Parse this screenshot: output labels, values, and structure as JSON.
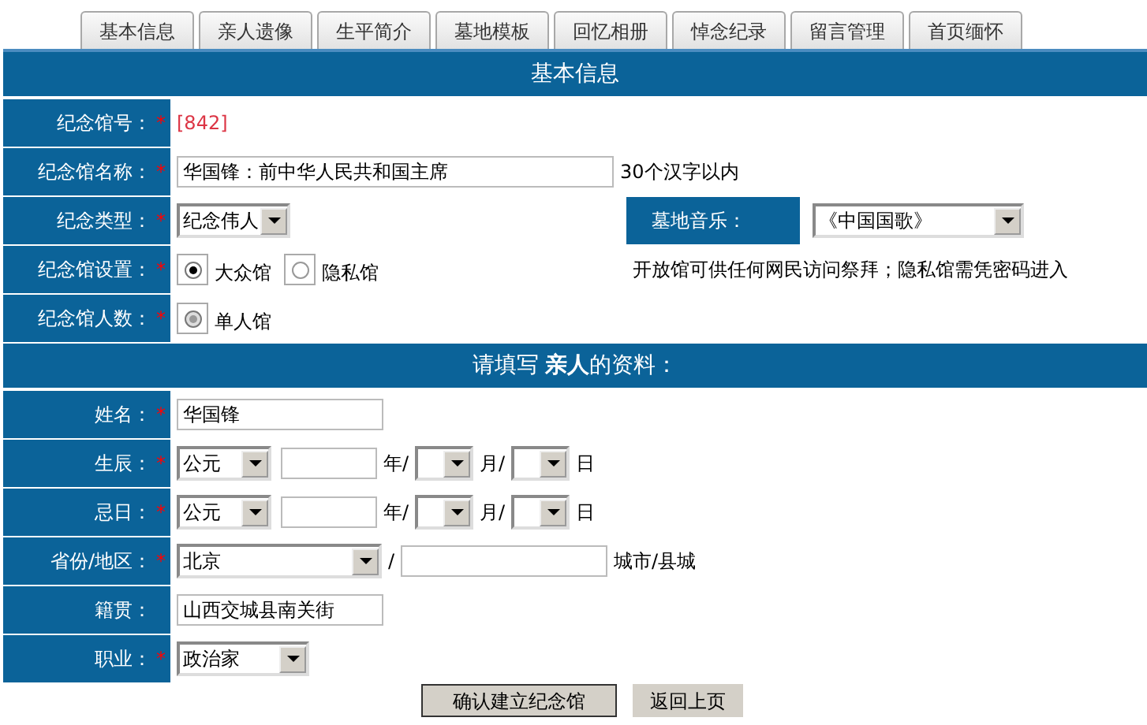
{
  "tabs": [
    {
      "label": "基本信息"
    },
    {
      "label": "亲人遗像"
    },
    {
      "label": "生平简介"
    },
    {
      "label": "墓地模板"
    },
    {
      "label": "回忆相册"
    },
    {
      "label": "悼念纪录"
    },
    {
      "label": "留言管理"
    },
    {
      "label": "首页缅怀"
    }
  ],
  "sections": [
    {
      "title": "基本信息",
      "rows": [
        {
          "kind": "static",
          "label": "纪念馆号：",
          "required_mark": "*",
          "value": "[842]"
        },
        {
          "kind": "input",
          "label": "纪念馆名称：",
          "required_mark": "*",
          "value": "华国锋：前中华人民共和国主席",
          "note": "30个汉字以内"
        },
        {
          "kind": "select_pair",
          "label": "纪念类型：",
          "required_mark": "*",
          "value": "纪念伟人",
          "label_2": "墓地音乐：",
          "value_2": "《中国国歌》"
        },
        {
          "kind": "radios",
          "label": "纪念馆设置：",
          "required_mark": "*",
          "options": [
            {
              "label": "大众馆",
              "selected": true,
              "disabled": false
            },
            {
              "label": "隐私馆",
              "selected": false,
              "disabled": false
            }
          ],
          "note": "开放馆可供任何网民访问祭拜；隐私馆需凭密码进入"
        },
        {
          "kind": "radios",
          "label": "纪念馆人数：",
          "required_mark": "*",
          "options": [
            {
              "label": "单人馆",
              "selected": true,
              "disabled": true
            }
          ]
        }
      ]
    },
    {
      "title": "请填写 **亲人**的资料：",
      "rows": [
        {
          "kind": "input",
          "label": "姓名：",
          "required_mark": "*",
          "value": "华国锋"
        },
        {
          "kind": "date",
          "label": "生辰：",
          "required_mark": "*",
          "era": "公元",
          "year_unit": "年/",
          "month_unit": "月/",
          "day_unit": "日"
        },
        {
          "kind": "date",
          "label": "忌日：",
          "required_mark": "*",
          "era": "公元",
          "year_unit": "年/",
          "month_unit": "月/",
          "day_unit": "日"
        },
        {
          "kind": "region",
          "label": "省份/地区：",
          "required_mark": "*",
          "value": "北京",
          "separator": "/",
          "suffix": "城市/县城"
        },
        {
          "kind": "input",
          "label": "籍贯：",
          "value": "山西交城县南关街"
        },
        {
          "kind": "select",
          "label": "职业：",
          "required_mark": "*",
          "value": "政治家"
        }
      ]
    }
  ],
  "buttons": [
    {
      "label": "确认建立纪念馆",
      "kind": "primary"
    },
    {
      "label": "返回上页",
      "kind": "secondary"
    }
  ]
}
